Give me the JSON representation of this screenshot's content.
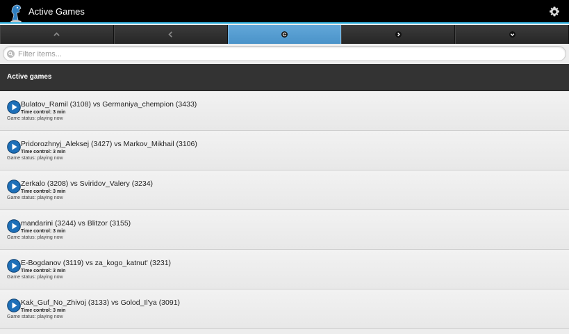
{
  "app": {
    "title": "Active Games"
  },
  "nav": {
    "buttons": [
      {
        "icon": "up-arrow-icon",
        "active": false
      },
      {
        "icon": "left-arrow-icon",
        "active": false
      },
      {
        "icon": "refresh-icon",
        "active": true
      },
      {
        "icon": "right-arrow-icon",
        "active": false
      },
      {
        "icon": "down-arrow-icon",
        "active": false
      }
    ]
  },
  "filter": {
    "placeholder": "Filter items..."
  },
  "section": {
    "title": "Active games"
  },
  "games": [
    {
      "title": "Bulatov_Ramil (3108) vs Germaniya_chempion (3433)",
      "time_control": "Time control: 3 min",
      "status": "Game status: playing now"
    },
    {
      "title": "Pridorozhnyj_Aleksej (3427) vs Markov_Mikhail (3106)",
      "time_control": "Time control: 3 min",
      "status": "Game status: playing now"
    },
    {
      "title": "Zerkalo (3208) vs Sviridov_Valery (3234)",
      "time_control": "Time control: 3 min",
      "status": "Game status: playing now"
    },
    {
      "title": "mandarini (3244) vs Blitzor (3155)",
      "time_control": "Time control: 3 min",
      "status": "Game status: playing now"
    },
    {
      "title": "E-Bogdanov (3119) vs za_kogo_katnut' (3231)",
      "time_control": "Time control: 3 min",
      "status": "Game status: playing now"
    },
    {
      "title": "Kak_Guf_No_Zhivoj (3133) vs Golod_Il'ya (3091)",
      "time_control": "Time control: 3 min",
      "status": "Game status: playing now"
    }
  ],
  "colors": {
    "accent": "#33b5e5",
    "active_tab": "#4a93c9",
    "play_button": "#1d6fb8"
  }
}
